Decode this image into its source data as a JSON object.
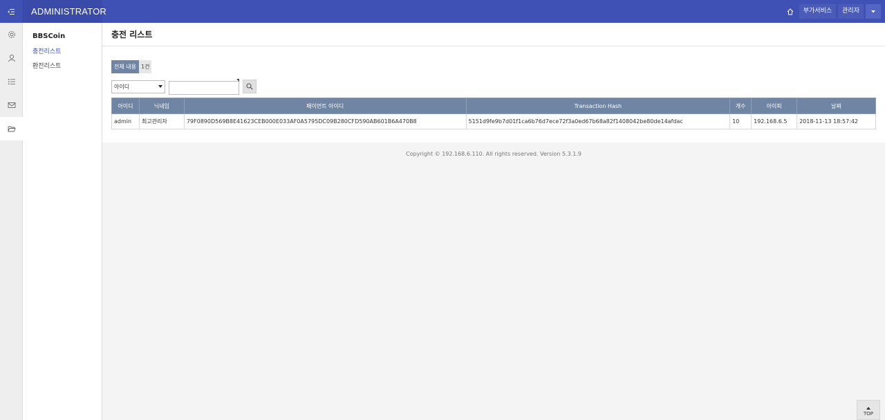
{
  "header": {
    "brand": "ADMINISTRATOR",
    "extra_service": "부가서비스",
    "admin_label": "관리자"
  },
  "rail": {
    "icons": [
      "gear-icon",
      "user-icon",
      "list-icon",
      "mail-icon",
      "folder-icon"
    ]
  },
  "submenu": {
    "title": "BBSCoin",
    "items": [
      {
        "label": "충전리스트",
        "active": true
      },
      {
        "label": "환전리스트",
        "active": false
      }
    ]
  },
  "page": {
    "title": "충전 리스트",
    "count_label": "전체 내용",
    "count_value": "1건"
  },
  "search": {
    "field_selected": "아이디",
    "query": ""
  },
  "table": {
    "columns": [
      "아이디",
      "닉네임",
      "페이먼트 아이디",
      "Transaction Hash",
      "개수",
      "아이피",
      "날짜"
    ],
    "rows": [
      [
        "admin",
        "최고관리자",
        "79F0890D569B8E41623CEB000E033AF0A5795DC09B280CFD590AB601B6A470B8",
        "5151d9fe9b7d01f1ca6b76d7ece72f3a0ed67b68a82f1408042be80de14afdac",
        "10",
        "192.168.6.5",
        "2018-11-13 18:57:42"
      ]
    ]
  },
  "footer": {
    "copyright": "Copyright © 192.168.6.110. All rights reserved. Version 5.3.1.9"
  },
  "top_button": "TOP",
  "colors": {
    "header": "#3f51b5",
    "table_header": "#6f85a3",
    "active_link": "#3f51b5"
  }
}
